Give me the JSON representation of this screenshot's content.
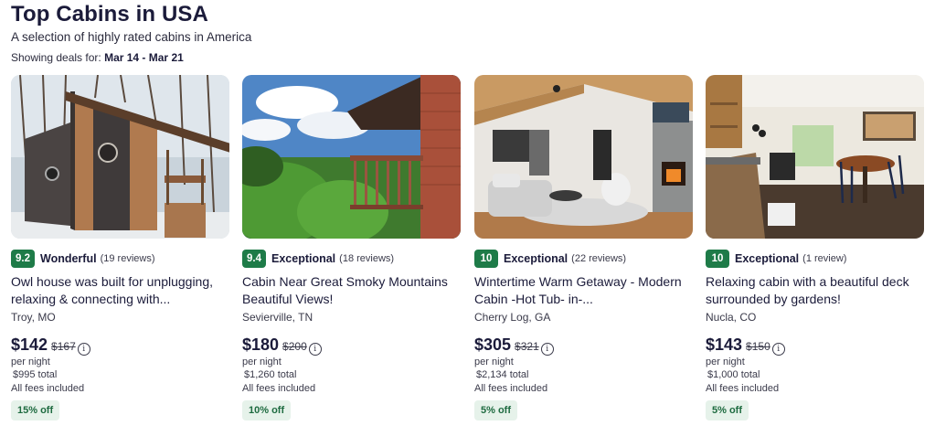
{
  "header": {
    "title": "Top Cabins in USA",
    "subtitle": "A selection of highly rated cabins in America",
    "deals_prefix": "Showing deals for:",
    "deals_dates": "Mar 14 - Mar 21"
  },
  "listings": [
    {
      "score": "9.2",
      "rating_word": "Wonderful",
      "reviews": "(19 reviews)",
      "name": "Owl house was built for unplugging, relaxing & connecting with...",
      "location": "Troy, MO",
      "price": "$142",
      "old_price": "$167",
      "per_night": "per night",
      "total": "$995 total",
      "fees": "All fees included",
      "discount": "15% off"
    },
    {
      "score": "9.4",
      "rating_word": "Exceptional",
      "reviews": "(18 reviews)",
      "name": "Cabin Near Great Smoky Mountains Beautiful Views!",
      "location": "Sevierville, TN",
      "price": "$180",
      "old_price": "$200",
      "per_night": "per night",
      "total": "$1,260 total",
      "fees": "All fees included",
      "discount": "10% off"
    },
    {
      "score": "10",
      "rating_word": "Exceptional",
      "reviews": "(22 reviews)",
      "name": "Wintertime Warm Getaway - Modern Cabin -Hot Tub- in-...",
      "location": "Cherry Log, GA",
      "price": "$305",
      "old_price": "$321",
      "per_night": "per night",
      "total": "$2,134 total",
      "fees": "All fees included",
      "discount": "5% off"
    },
    {
      "score": "10",
      "rating_word": "Exceptional",
      "reviews": "(1 review)",
      "name": "Relaxing cabin with a beautiful deck surrounded by gardens!",
      "location": "Nucla, CO",
      "price": "$143",
      "old_price": "$150",
      "per_night": "per night",
      "total": "$1,000 total",
      "fees": "All fees included",
      "discount": "5% off"
    }
  ],
  "icons": {
    "info": "info-icon"
  },
  "colors": {
    "score_badge": "#1e7b48",
    "discount_bg": "#e6f2ea",
    "discount_text": "#1e6b40"
  }
}
